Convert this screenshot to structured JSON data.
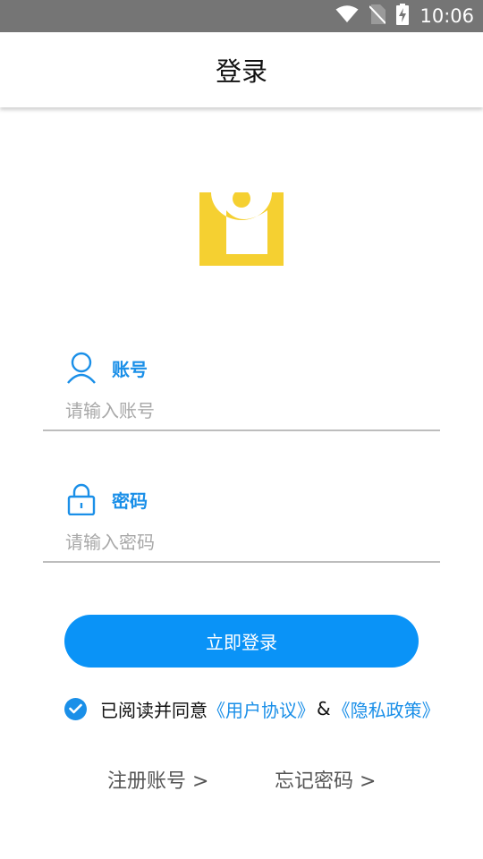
{
  "status_bar": {
    "time": "10:06",
    "icons": [
      "wifi-icon",
      "no-sim-icon",
      "battery-charging-icon"
    ],
    "background": "#757575"
  },
  "header": {
    "title": "登录"
  },
  "logo": {
    "icon": "app-logo",
    "color": "#f5d031"
  },
  "form": {
    "account": {
      "label": "账号",
      "icon": "user-icon",
      "placeholder": "请输入账号",
      "value": ""
    },
    "password": {
      "label": "密码",
      "icon": "lock-icon",
      "placeholder": "请输入密码",
      "value": ""
    }
  },
  "login_button": {
    "label": "立即登录",
    "color": "#0a93f7"
  },
  "agreement": {
    "checked": true,
    "text": "已阅读并同意",
    "user_agreement": "《用户协议》",
    "and": "&",
    "privacy_policy": "《隐私政策》"
  },
  "links": {
    "register": "注册账号 >",
    "forgot_password": "忘记密码 >"
  },
  "accent_color": "#1a8fe8"
}
